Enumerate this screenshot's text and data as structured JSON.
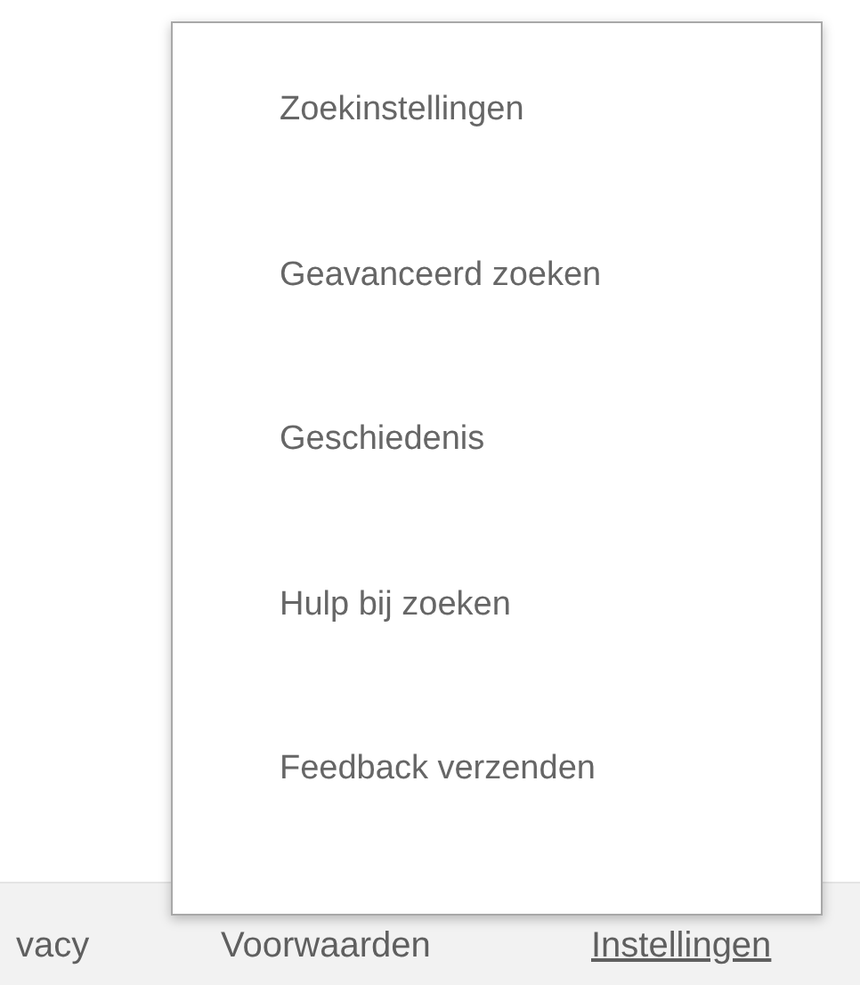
{
  "menu": {
    "items": [
      {
        "label": "Zoekinstellingen"
      },
      {
        "label": "Geavanceerd zoeken"
      },
      {
        "label": "Geschiedenis"
      },
      {
        "label": "Hulp bij zoeken"
      },
      {
        "label": "Feedback verzenden"
      }
    ]
  },
  "footer": {
    "links": [
      {
        "label": "vacy",
        "selected": false
      },
      {
        "label": "Voorwaarden",
        "selected": false
      },
      {
        "label": "Instellingen",
        "selected": true
      }
    ]
  }
}
